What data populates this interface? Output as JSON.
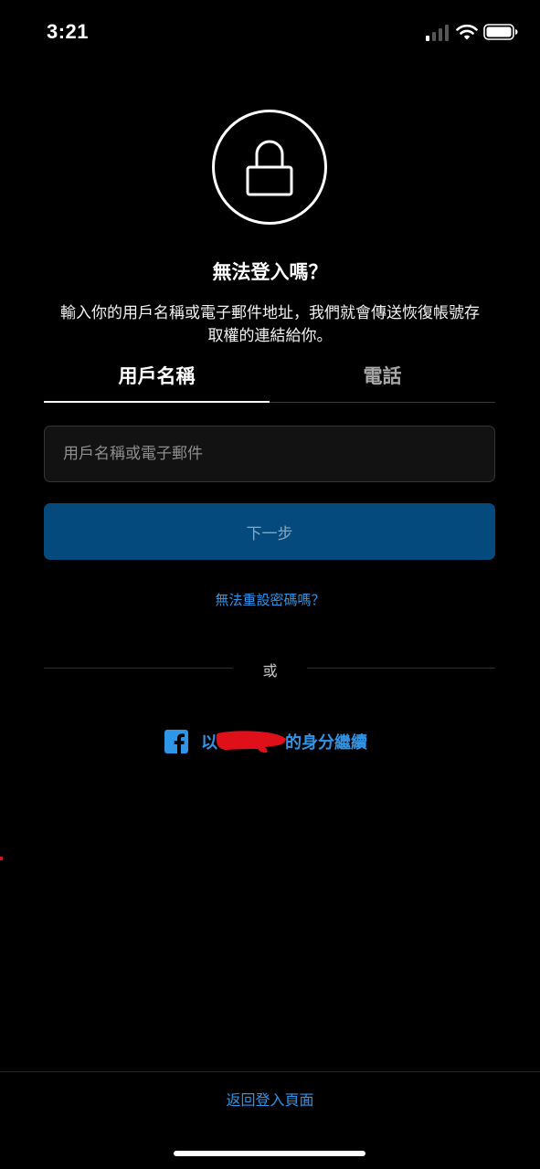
{
  "status_bar": {
    "time": "3:21",
    "signal_icon": "cellular-signal-icon",
    "wifi_icon": "wifi-icon",
    "battery_icon": "battery-icon"
  },
  "header": {
    "icon": "lock-icon",
    "title": "無法登入嗎？",
    "description": "輸入你的用戶名稱或電子郵件地址，我們就會傳送恢復帳號存取權的連結給你。"
  },
  "tabs": [
    {
      "label": "用戶名稱",
      "active": true
    },
    {
      "label": "電話",
      "active": false
    }
  ],
  "form": {
    "input_placeholder": "用戶名稱或電子郵件",
    "input_value": "",
    "next_button_label": "下一步"
  },
  "reset_password_link": "無法重設密碼嗎？",
  "divider_text": "或",
  "facebook": {
    "icon": "facebook-icon",
    "prefix": "以",
    "suffix": "的身分繼續"
  },
  "footer": {
    "back_to_login": "返回登入頁面"
  },
  "colors": {
    "background": "#000000",
    "link_blue": "#2f95e8",
    "button_blue": "#054a7d",
    "redaction_red": "#e0101a"
  }
}
